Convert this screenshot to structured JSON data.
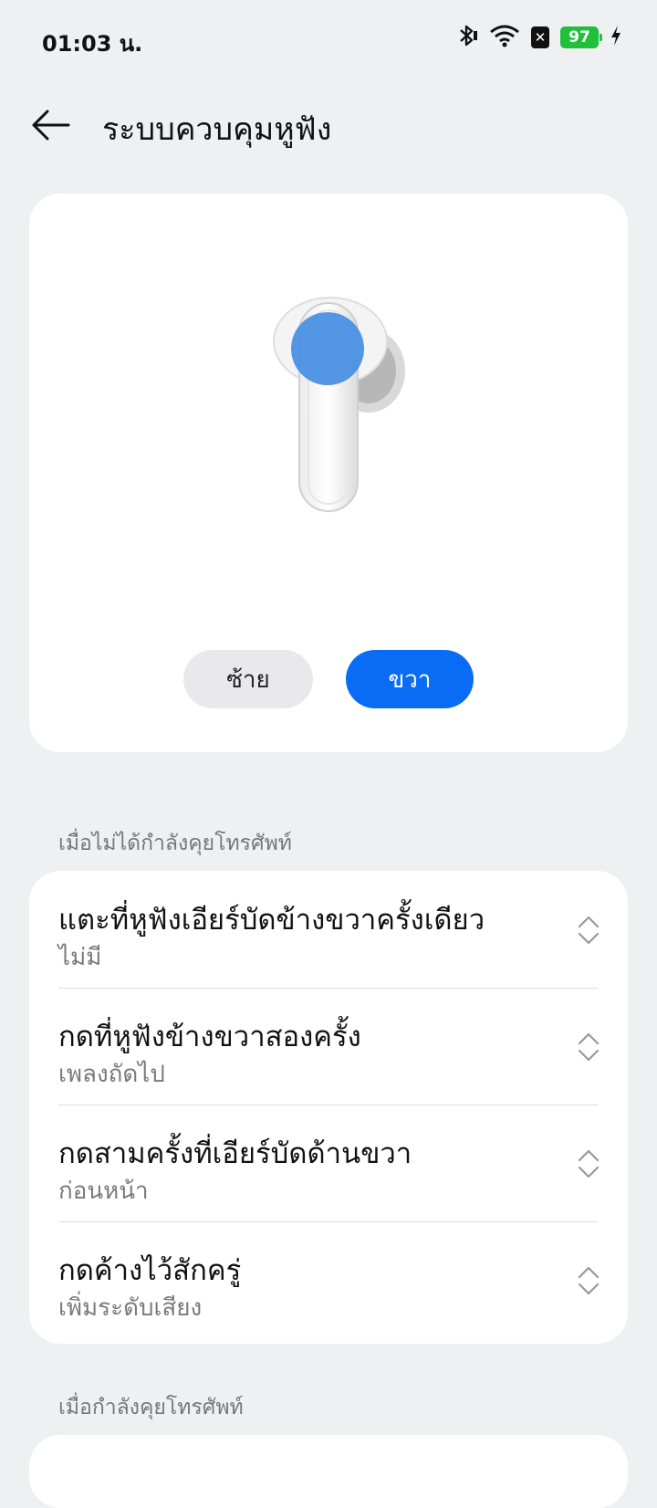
{
  "status_bar": {
    "time": "01:03 น.",
    "battery": "97",
    "icons": [
      "bluetooth-icon",
      "wifi-icon",
      "sim-off-icon",
      "battery-icon",
      "charging-icon"
    ]
  },
  "header": {
    "title": "ระบบควบคุมหูฟัง"
  },
  "preview": {
    "left_label": "ซ้าย",
    "right_label": "ขวา",
    "selected": "ขวา"
  },
  "sections": [
    {
      "label": "เมื่อไม่ได้กำลังคุยโทรศัพท์",
      "items": [
        {
          "title": "แตะที่หูฟังเอียร์บัดข้างขวาครั้งเดียว",
          "value": "ไม่มี"
        },
        {
          "title": "กดที่หูฟังข้างขวาสองครั้ง",
          "value": "เพลงถัดไป"
        },
        {
          "title": "กดสามครั้งที่เอียร์บัดด้านขวา",
          "value": "ก่อนหน้า"
        },
        {
          "title": "กดค้างไว้สักครู่",
          "value": "เพิ่มระดับเสียง"
        }
      ]
    },
    {
      "label": "เมื่อกำลังคุยโทรศัพท์",
      "items": []
    }
  ],
  "colors": {
    "accent": "#0a6cf5",
    "background": "#eff0f2",
    "battery": "#22c03a",
    "touch_area": "#4a90e2"
  }
}
